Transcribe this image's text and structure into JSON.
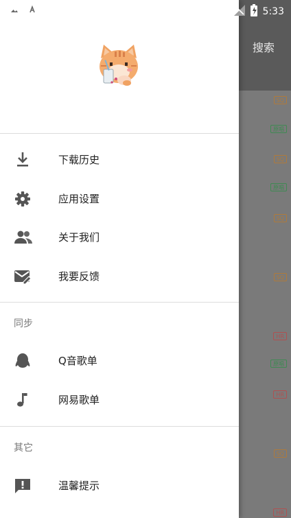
{
  "status_bar": {
    "time": "5:33"
  },
  "background_app": {
    "search_label": "搜索",
    "tags": [
      {
        "text": "SQ",
        "kind": "sq"
      },
      {
        "text": "原唱",
        "kind": "orig"
      },
      {
        "text": "SQ",
        "kind": "sq"
      },
      {
        "text": "原唱",
        "kind": "orig"
      },
      {
        "text": "SQ",
        "kind": "sq"
      },
      {
        "text": "SQ",
        "kind": "sq"
      },
      {
        "text": "HR",
        "kind": "hr"
      },
      {
        "text": "原唱",
        "kind": "orig"
      },
      {
        "text": "HR",
        "kind": "hr"
      },
      {
        "text": "SQ",
        "kind": "sq"
      },
      {
        "text": "HR",
        "kind": "hr"
      }
    ]
  },
  "drawer": {
    "menu": [
      {
        "label": "下载历史",
        "icon": "download-icon"
      },
      {
        "label": "应用设置",
        "icon": "gear-icon"
      },
      {
        "label": "关于我们",
        "icon": "people-icon"
      },
      {
        "label": "我要反馈",
        "icon": "feedback-mail-icon"
      }
    ],
    "sync_section": {
      "title": "同步",
      "items": [
        {
          "label": "Q音歌单",
          "icon": "qq-penguin-icon"
        },
        {
          "label": "网易歌单",
          "icon": "music-note-icon"
        }
      ]
    },
    "other_section": {
      "title": "其它",
      "items": [
        {
          "label": "温馨提示",
          "icon": "alert-message-icon"
        }
      ]
    }
  }
}
